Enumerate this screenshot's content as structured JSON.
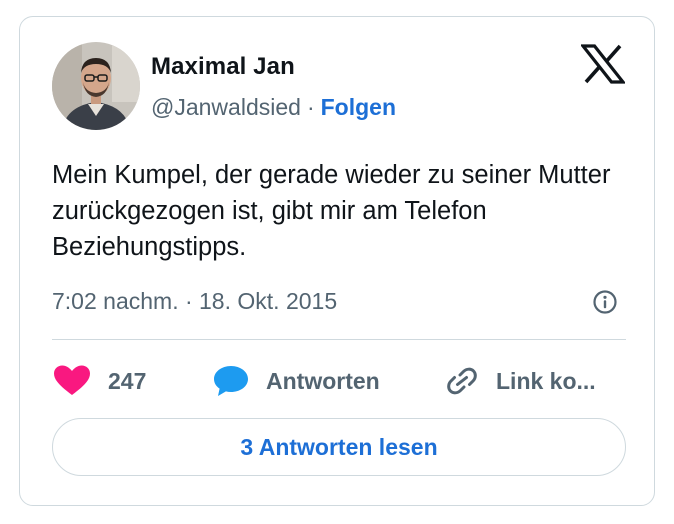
{
  "author": {
    "name": "Maximal Jan",
    "handle": "@Janwaldsied",
    "separator": "·",
    "follow_label": "Folgen"
  },
  "tweet": {
    "text": "Mein Kumpel, der gerade wieder zu seiner Mutter zurückgezogen ist, gibt mir am Telefon Beziehungstipps.",
    "timestamp": "7:02 nachm. · 18. Okt. 2015"
  },
  "actions": {
    "like_count": "247",
    "reply_label": "Antworten",
    "link_label": "Link ko..."
  },
  "read_replies_label": "3 Antworten lesen",
  "icons": {
    "brand": "x-logo-icon",
    "info": "info-icon",
    "like": "heart-icon",
    "reply": "speech-bubble-icon",
    "link": "link-icon"
  },
  "colors": {
    "accent": "#1d6fd6",
    "heart": "#f91880",
    "reply": "#1d9bf0",
    "muted_text": "#536471",
    "border": "#cfd9de"
  }
}
